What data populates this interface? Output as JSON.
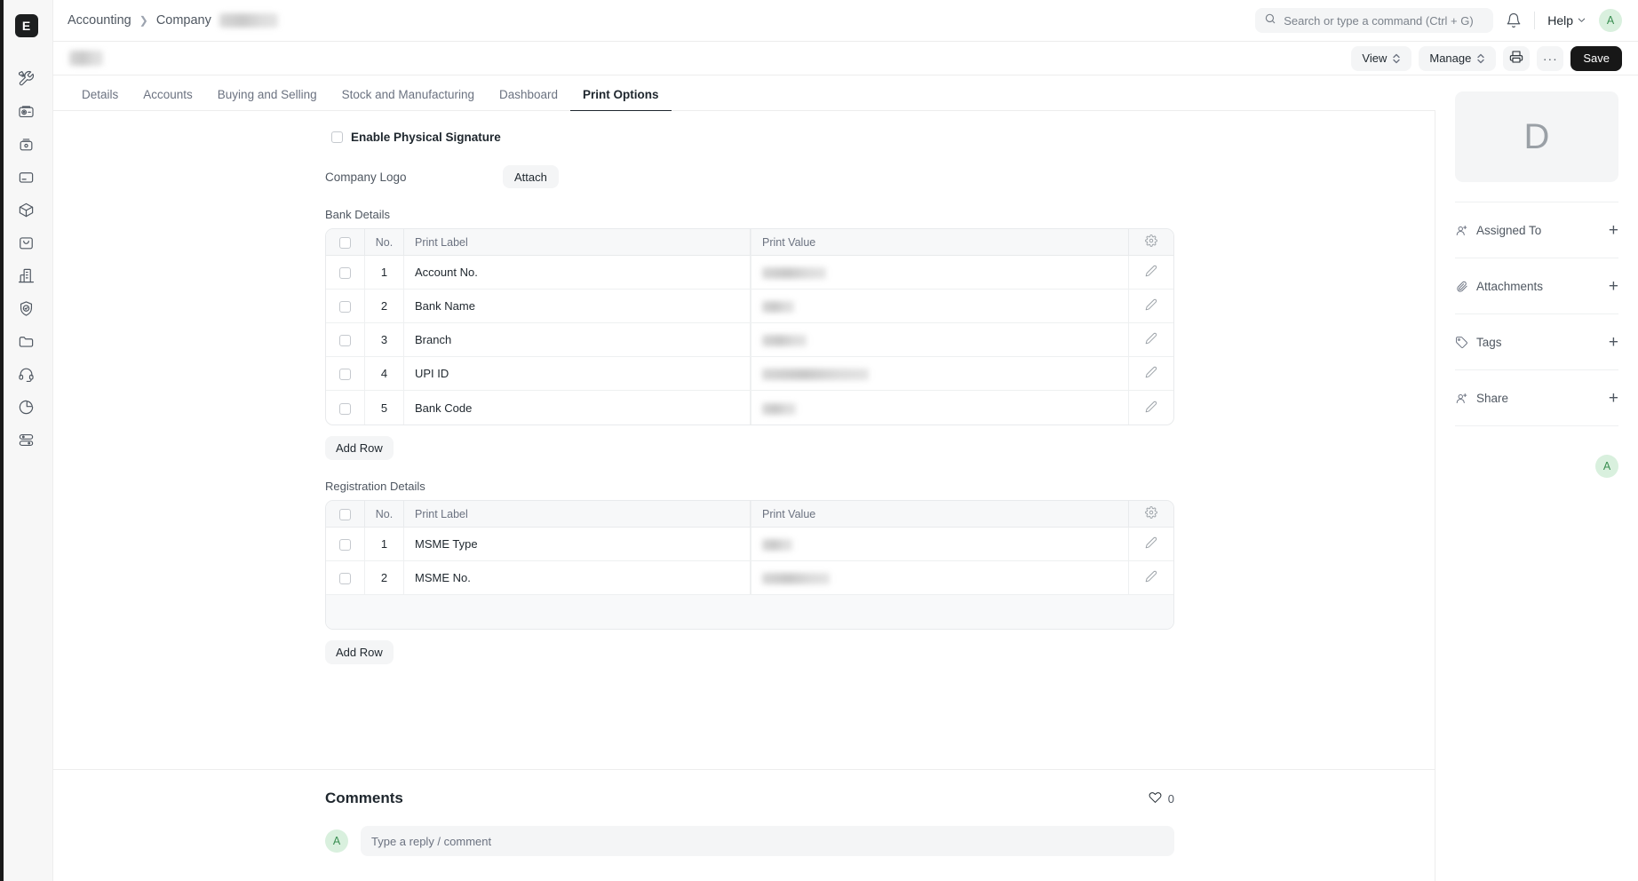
{
  "app": {
    "logo_letter": "E",
    "rail_icons": [
      {
        "name": "tools-icon"
      },
      {
        "name": "projector-icon"
      },
      {
        "name": "camera-icon"
      },
      {
        "name": "card-icon"
      },
      {
        "name": "package-icon"
      },
      {
        "name": "shopping-bag-icon"
      },
      {
        "name": "building-icon"
      },
      {
        "name": "shield-check-icon"
      },
      {
        "name": "folder-icon"
      },
      {
        "name": "headset-icon"
      },
      {
        "name": "pie-chart-icon"
      },
      {
        "name": "toggles-icon"
      }
    ]
  },
  "navbar": {
    "breadcrumb": [
      {
        "label": "Accounting",
        "redacted": false
      },
      {
        "label": "Company",
        "redacted": false
      },
      {
        "label": "",
        "redacted": true
      }
    ],
    "search_placeholder": "Search or type a command (Ctrl + G)",
    "notifications_icon": "bell-icon",
    "help_label": "Help",
    "user_initial": "A"
  },
  "page_head": {
    "title": "",
    "title_redacted": true,
    "actions": {
      "view_label": "View",
      "manage_label": "Manage",
      "print_icon": "printer-icon",
      "more_label": "···",
      "save_label": "Save"
    }
  },
  "tabs": [
    {
      "label": "Details",
      "active": false
    },
    {
      "label": "Accounts",
      "active": false
    },
    {
      "label": "Buying and Selling",
      "active": false
    },
    {
      "label": "Stock and Manufacturing",
      "active": false
    },
    {
      "label": "Dashboard",
      "active": false
    },
    {
      "label": "Print Options",
      "active": true
    }
  ],
  "form": {
    "enable_physical_signature": {
      "label": "Enable Physical Signature",
      "checked": false
    },
    "company_logo": {
      "label": "Company Logo",
      "attach_label": "Attach"
    },
    "bank_details": {
      "section_label": "Bank Details",
      "columns": [
        "No.",
        "Print Label",
        "Print Value"
      ],
      "rows": [
        {
          "no": "1",
          "print_label": "Account No.",
          "print_value": "",
          "value_redacted": true,
          "value_width": 72
        },
        {
          "no": "2",
          "print_label": "Bank Name",
          "print_value": "",
          "value_redacted": true,
          "value_width": 36
        },
        {
          "no": "3",
          "print_label": "Branch",
          "print_value": "",
          "value_redacted": true,
          "value_width": 50
        },
        {
          "no": "4",
          "print_label": "UPI ID",
          "print_value": "",
          "value_redacted": true,
          "value_width": 120
        },
        {
          "no": "5",
          "print_label": "Bank Code",
          "print_value": "",
          "value_redacted": true,
          "value_width": 38
        }
      ],
      "add_row_label": "Add Row",
      "settings_icon": "gear-icon",
      "edit_icon": "pencil-icon"
    },
    "registration_details": {
      "section_label": "Registration Details",
      "columns": [
        "No.",
        "Print Label",
        "Print Value"
      ],
      "rows": [
        {
          "no": "1",
          "print_label": "MSME Type",
          "print_value": "",
          "value_redacted": true,
          "value_width": 34
        },
        {
          "no": "2",
          "print_label": "MSME No.",
          "print_value": "",
          "value_redacted": true,
          "value_width": 76
        }
      ],
      "add_row_label": "Add Row",
      "settings_icon": "gear-icon",
      "edit_icon": "pencil-icon"
    }
  },
  "comments": {
    "title": "Comments",
    "like_count": "0",
    "like_icon": "heart-icon",
    "avatar_initial": "A",
    "reply_placeholder": "Type a reply / comment"
  },
  "sidebar": {
    "thumbnail_letter": "D",
    "items": [
      {
        "label": "Assigned To",
        "icon": "user-plus-icon",
        "action": "+"
      },
      {
        "label": "Attachments",
        "icon": "paperclip-icon",
        "action": "+"
      },
      {
        "label": "Tags",
        "icon": "tag-icon",
        "action": "+"
      },
      {
        "label": "Share",
        "icon": "user-plus-icon",
        "action": "+"
      }
    ],
    "follower_initial": "A"
  },
  "colors": {
    "accent_dark": "#171717",
    "avatar_green_bg": "#d9f0de",
    "avatar_green_fg": "#3a8f52",
    "muted": "#6b7280",
    "surface": "#f4f5f6"
  }
}
